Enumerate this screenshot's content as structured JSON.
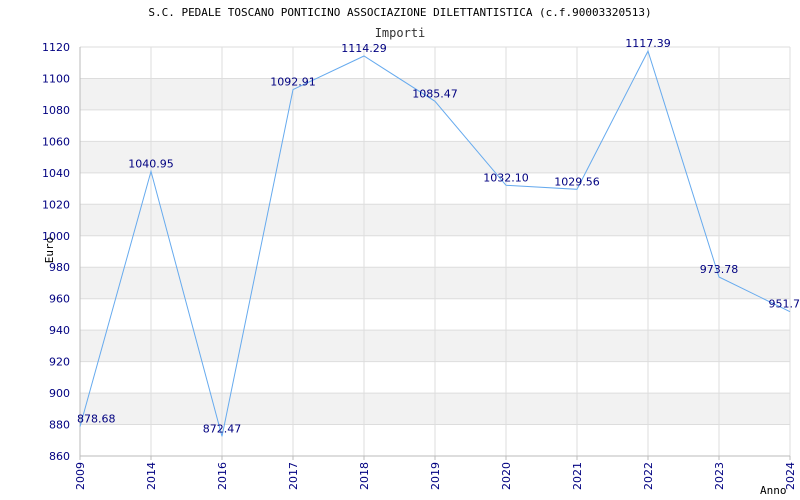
{
  "chart_data": {
    "type": "line",
    "title": "S.C. PEDALE TOSCANO PONTICINO ASSOCIAZIONE DILETTANTISTICA (c.f.90003320513)",
    "subtitle": "Importi",
    "xlabel": "Anno",
    "ylabel": "Euro",
    "categories": [
      "2009",
      "2014",
      "2016",
      "2017",
      "2018",
      "2019",
      "2020",
      "2021",
      "2022",
      "2023",
      "2024"
    ],
    "values": [
      878.68,
      1040.95,
      872.47,
      1092.91,
      1114.29,
      1085.47,
      1032.1,
      1029.56,
      1117.39,
      973.78,
      951.7
    ],
    "value_labels": [
      "878.68",
      "1040.95",
      "872.47",
      "1092.91",
      "1114.29",
      "1085.47",
      "1032.10",
      "1029.56",
      "1117.39",
      "973.78",
      "951.7"
    ],
    "y_ticks": [
      860,
      880,
      900,
      920,
      940,
      960,
      980,
      1000,
      1020,
      1040,
      1060,
      1080,
      1100,
      1120
    ],
    "ylim": [
      860,
      1120
    ],
    "grid": true,
    "legend": "none",
    "colors": {
      "line": "#66aaee",
      "band": "#f2f2f2",
      "grid": "#dddddd",
      "axis": "#bbbbbb",
      "tick_text": "#000080"
    }
  }
}
